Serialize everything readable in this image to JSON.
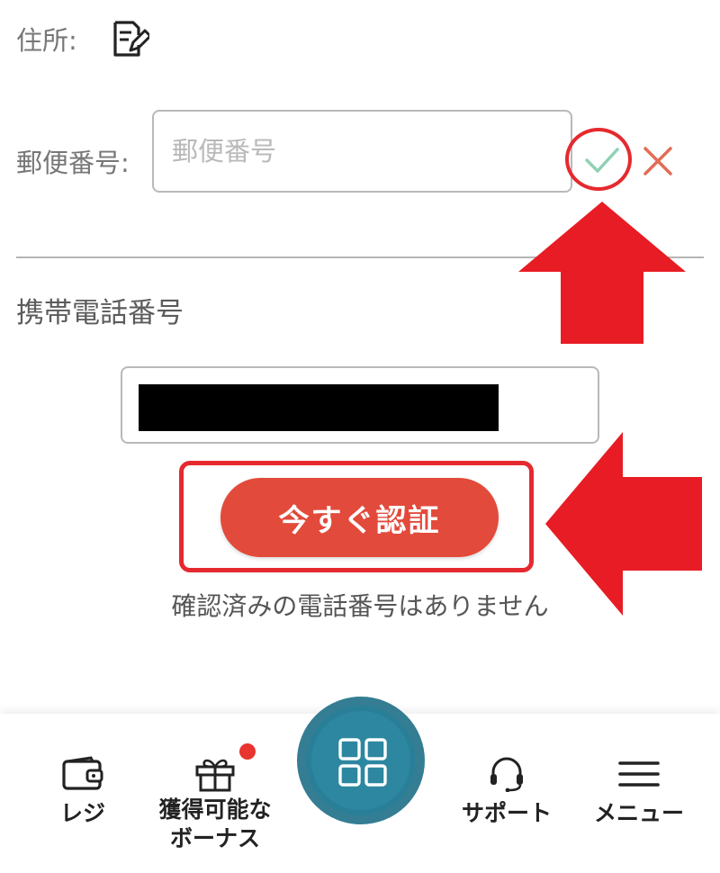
{
  "address": {
    "label": "住所:",
    "edit_icon": "edit-icon"
  },
  "postal": {
    "label": "郵便番号:",
    "placeholder": "郵便番号",
    "value": "",
    "confirm_icon": "check-icon",
    "cancel_icon": "close-icon"
  },
  "mobile": {
    "label": "携帯電話番号",
    "verify_label": "今すぐ認証",
    "status_text": "確認済みの電話番号はありません"
  },
  "tabbar": {
    "register_label": "レジ",
    "bonus_label": "獲得可能なボーナス",
    "support_label": "サポート",
    "menu_label": "メニュー"
  },
  "colors": {
    "accent": "#e24a3b",
    "annotation": "#e52a2f",
    "fab": "#2d87a0",
    "check": "#8fd1b3"
  }
}
